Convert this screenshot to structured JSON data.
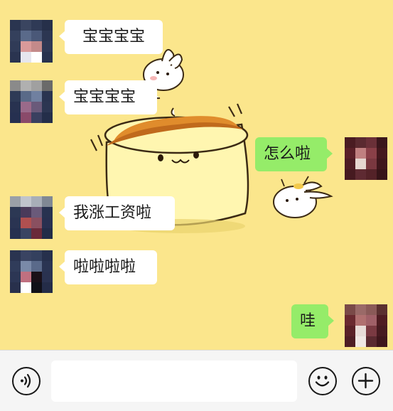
{
  "messages": [
    {
      "side": "left",
      "text": "宝宝宝宝"
    },
    {
      "side": "left",
      "text": "宝宝宝宝"
    },
    {
      "side": "right",
      "text": "怎么啦"
    },
    {
      "side": "left",
      "text": "我涨工资啦"
    },
    {
      "side": "left",
      "text": "啦啦啦啦"
    },
    {
      "side": "right",
      "text": "哇"
    }
  ],
  "input": {
    "value": "",
    "placeholder": ""
  },
  "icons": {
    "voice": "voice-icon",
    "emoji": "emoji-icon",
    "add": "plus-icon"
  },
  "colors": {
    "chat_background": "#fbe68c",
    "sent_bubble": "#95ec69",
    "received_bubble": "#ffffff",
    "input_bar": "#f5f5f5"
  }
}
